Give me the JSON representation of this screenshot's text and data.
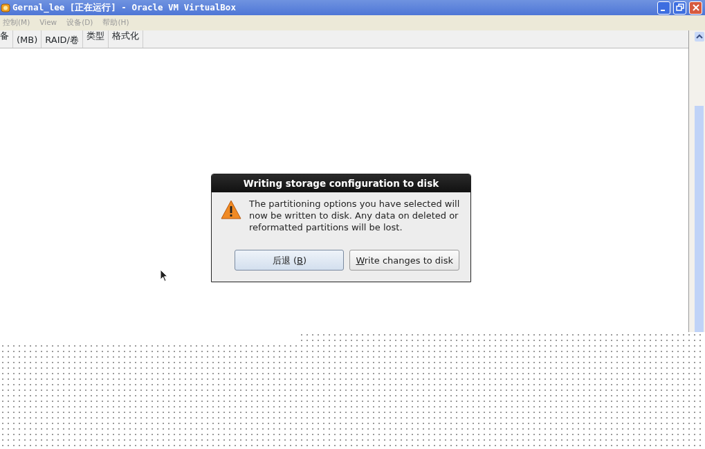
{
  "window": {
    "title": "Gernal_lee [正在运行] - Oracle VM VirtualBox"
  },
  "menu": [
    {
      "label": "控制(M)"
    },
    {
      "label": "View"
    },
    {
      "label": "设备(D)"
    },
    {
      "label": "帮助(H)"
    }
  ],
  "table": {
    "columns": [
      {
        "label": "备"
      },
      {
        "label": "(MB)"
      },
      {
        "label": "RAID/卷"
      },
      {
        "label": "类型"
      },
      {
        "label": "格式化"
      }
    ]
  },
  "dialog": {
    "title": "Writing storage configuration to disk",
    "message": "The partitioning options you have selected will now be written to disk.  Any data on deleted or reformatted partitions will be lost.",
    "buttons": [
      {
        "prefix": "后退 (",
        "key": "B",
        "suffix": ")",
        "default": true
      },
      {
        "key": "W",
        "suffix": "rite changes to disk",
        "default": false
      }
    ]
  }
}
